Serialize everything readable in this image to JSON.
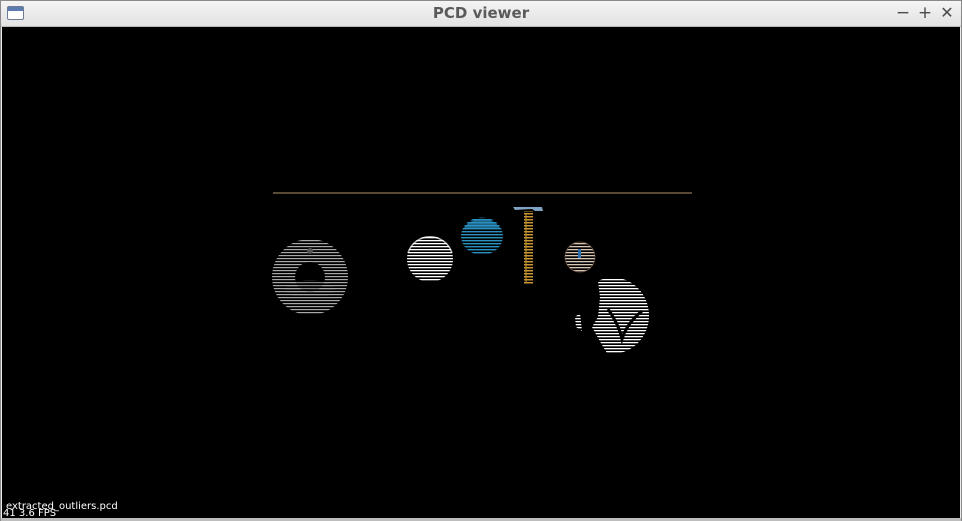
{
  "window": {
    "title": "PCD viewer",
    "controls": {
      "minimize": "−",
      "maximize": "+",
      "close": "✕"
    },
    "icon": "window-icon"
  },
  "viewer": {
    "background": "#000000",
    "filename": "extracted_outliers.pcd",
    "fps": "41 3.6 FPS",
    "colors": {
      "table_edge": "#5a4a35",
      "blue_sphere": "#2a90c0",
      "hammer_handle": "#c89434",
      "hammer_head": "#7ea1c4",
      "white": "#ffffff",
      "gray": "#9a9a9a"
    }
  }
}
